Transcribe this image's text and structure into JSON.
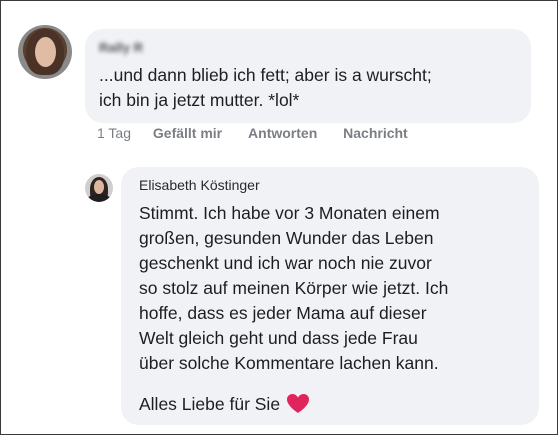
{
  "comment": {
    "author": "Rally R",
    "lines": [
      "...und dann blieb ich fett; aber is a wurscht;",
      "ich bin ja jetzt mutter. *lol*"
    ],
    "actions": {
      "time": "1 Tag",
      "like": "Gefällt mir",
      "reply": "Antworten",
      "message": "Nachricht"
    }
  },
  "reply": {
    "author": "Elisabeth Köstinger",
    "lines": [
      "Stimmt. Ich habe vor 3 Monaten einem",
      "großen, gesunden Wunder das Leben",
      "geschenkt und ich war noch nie zuvor",
      "so stolz auf meinen Körper wie jetzt. Ich",
      "hoffe, dass es jeder Mama auf dieser",
      "Welt gleich geht und dass jede Frau",
      "über solche Kommentare lachen kann."
    ],
    "closing": "Alles Liebe für Sie",
    "closing_icon": "heart-icon",
    "heart_color": "#e0245e"
  },
  "colors": {
    "bubble": "#f0f2f5",
    "action_text": "#7b7f85"
  }
}
